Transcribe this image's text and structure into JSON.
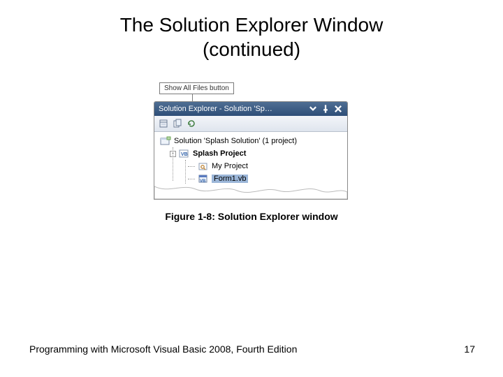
{
  "title_line1": "The Solution Explorer Window",
  "title_line2": "(continued)",
  "callout": "Show All Files button",
  "panel": {
    "title": "Solution Explorer - Solution 'Sp…"
  },
  "tree": {
    "solution": "Solution 'Splash Solution' (1 project)",
    "project": "Splash Project",
    "myproject": "My Project",
    "form": "Form1.vb"
  },
  "caption": "Figure 1-8: Solution Explorer window",
  "footer_left": "Programming with Microsoft Visual Basic 2008, Fourth Edition",
  "footer_right": "17"
}
